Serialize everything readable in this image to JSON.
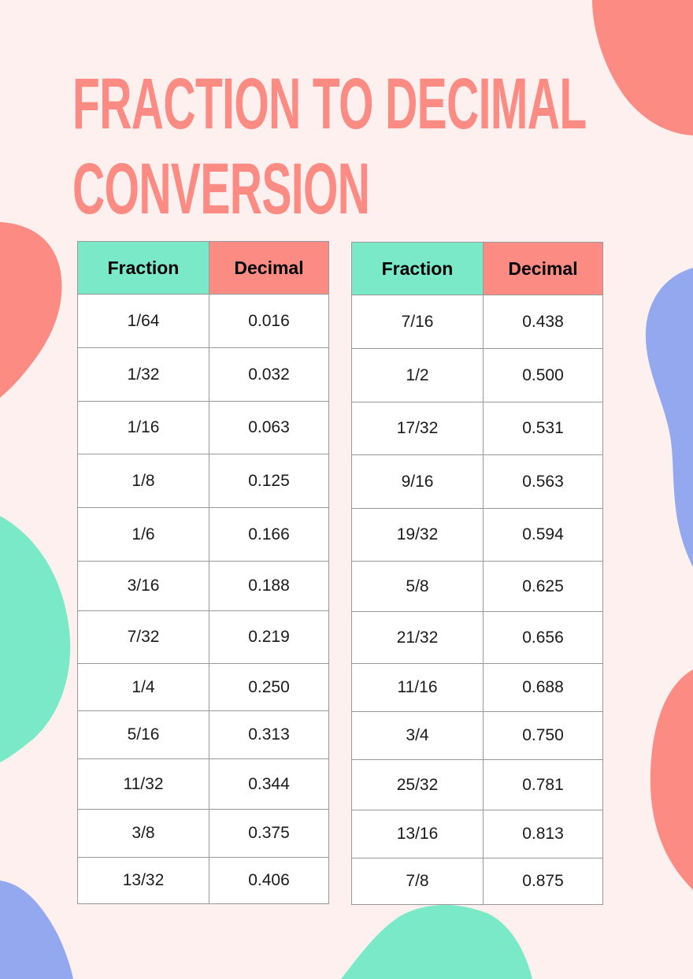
{
  "title": {
    "line1": "FRACTION TO DECIMAL",
    "line2": "CONVERSION"
  },
  "colors": {
    "background": "#fdf0ef",
    "title": "#fb8b83",
    "fraction_header": "#7ae9c7",
    "decimal_header": "#fb8b83",
    "blob_blue": "#94a8f0"
  },
  "tables": [
    {
      "headers": {
        "fraction": "Fraction",
        "decimal": "Decimal"
      },
      "rows": [
        {
          "fraction": "1/64",
          "decimal": "0.016"
        },
        {
          "fraction": "1/32",
          "decimal": "0.032"
        },
        {
          "fraction": "1/16",
          "decimal": "0.063"
        },
        {
          "fraction": "1/8",
          "decimal": "0.125"
        },
        {
          "fraction": "1/6",
          "decimal": "0.166"
        },
        {
          "fraction": "3/16",
          "decimal": "0.188"
        },
        {
          "fraction": "7/32",
          "decimal": "0.219"
        },
        {
          "fraction": "1/4",
          "decimal": "0.250"
        },
        {
          "fraction": "5/16",
          "decimal": "0.313"
        },
        {
          "fraction": "11/32",
          "decimal": "0.344"
        },
        {
          "fraction": "3/8",
          "decimal": "0.375"
        },
        {
          "fraction": "13/32",
          "decimal": "0.406"
        }
      ]
    },
    {
      "headers": {
        "fraction": "Fraction",
        "decimal": "Decimal"
      },
      "rows": [
        {
          "fraction": "7/16",
          "decimal": "0.438"
        },
        {
          "fraction": "1/2",
          "decimal": "0.500"
        },
        {
          "fraction": "17/32",
          "decimal": "0.531"
        },
        {
          "fraction": "9/16",
          "decimal": "0.563"
        },
        {
          "fraction": "19/32",
          "decimal": "0.594"
        },
        {
          "fraction": "5/8",
          "decimal": "0.625"
        },
        {
          "fraction": "21/32",
          "decimal": "0.656"
        },
        {
          "fraction": "11/16",
          "decimal": "0.688"
        },
        {
          "fraction": "3/4",
          "decimal": "0.750"
        },
        {
          "fraction": "25/32",
          "decimal": "0.781"
        },
        {
          "fraction": "13/16",
          "decimal": "0.813"
        },
        {
          "fraction": "7/8",
          "decimal": "0.875"
        }
      ]
    }
  ]
}
